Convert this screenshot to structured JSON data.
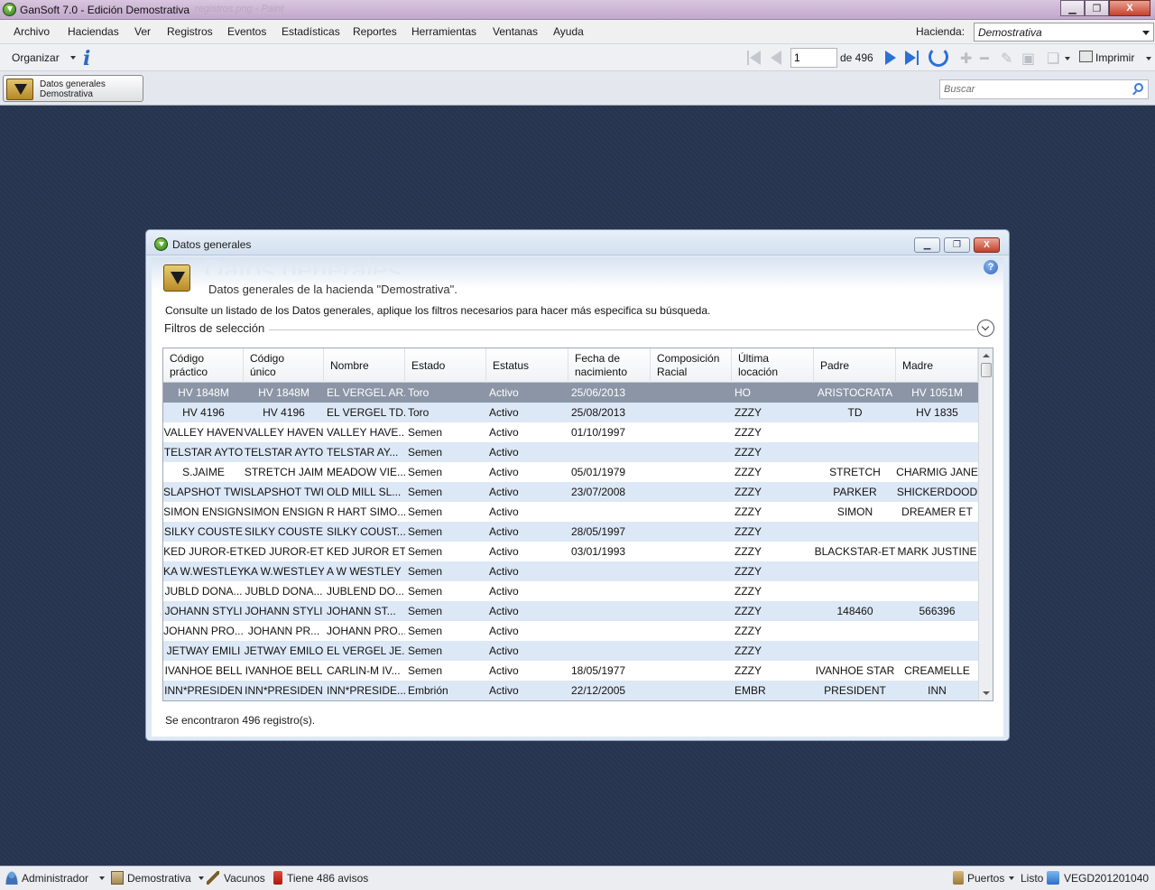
{
  "window": {
    "title": "GanSoft 7.0 - Edición Demostrativa",
    "ghost_text": "  registros.png - Paint",
    "min_label": "▁",
    "max_label": "❐",
    "close_label": "X"
  },
  "menu": {
    "items": [
      "Archivo",
      "Haciendas",
      "Ver",
      "Registros",
      "Eventos",
      "Estadísticas",
      "Reportes",
      "Herramientas",
      "Ventanas",
      "Ayuda"
    ],
    "hacienda_label": "Hacienda:",
    "hacienda_value": "Demostrativa"
  },
  "toolbar": {
    "organizar_label": "Organizar",
    "page_value": "1",
    "page_of": "de 496",
    "imprimir_label": "Imprimir"
  },
  "task_button": {
    "line1": "Datos generales",
    "line2": "Demostrativa"
  },
  "search": {
    "placeholder": "Buscar"
  },
  "inner_window": {
    "title": "Datos generales",
    "big_title": "Datos generales",
    "subtitle": "Datos generales de la hacienda \"Demostrativa\".",
    "description": "Consulte un listado de los Datos generales, aplique los filtros necesarios para hacer más especifica su búsqueda.",
    "filtros_label": "Filtros de selección",
    "help_label": "?",
    "result_text": "Se encontraron 496 registro(s)."
  },
  "table": {
    "columns": [
      "Código\npráctico",
      "Código\núnico",
      "Nombre",
      "Estado",
      "Estatus",
      "Fecha de\nnacimiento",
      "Composición\nRacial",
      "Última\nlocación",
      "Padre",
      "Madre"
    ],
    "rows": [
      [
        "HV 1848M",
        "HV 1848M",
        "EL VERGEL AR...",
        "Toro",
        "Activo",
        "25/06/2013",
        "",
        "HO",
        "ARISTOCRATA",
        "HV 1051M"
      ],
      [
        "HV 4196",
        "HV 4196",
        "EL VERGEL TD...",
        "Toro",
        "Activo",
        "25/08/2013",
        "",
        "ZZZY",
        "TD",
        "HV 1835"
      ],
      [
        "VALLEY HAVEN",
        "VALLEY HAVEN",
        "VALLEY HAVE...",
        "Semen",
        "Activo",
        "01/10/1997",
        "",
        "ZZZY",
        "",
        ""
      ],
      [
        "TELSTAR AYTO",
        "TELSTAR AYTO",
        "TELSTAR  AY...",
        "Semen",
        "Activo",
        "",
        "",
        "ZZZY",
        "",
        ""
      ],
      [
        "S.JAIME",
        "STRETCH JAIM",
        "MEADOW VIE...",
        "Semen",
        "Activo",
        "05/01/1979",
        "",
        "ZZZY",
        "STRETCH",
        "CHARMIG JANE"
      ],
      [
        "SLAPSHOT TWI",
        "SLAPSHOT TWI",
        "OLD MILL SL...",
        "Semen",
        "Activo",
        "23/07/2008",
        "",
        "ZZZY",
        "PARKER",
        "SHICKERDOOD"
      ],
      [
        "SIMON ENSIGN",
        "SIMON ENSIGN",
        "R HART SIMO...",
        "Semen",
        "Activo",
        "",
        "",
        "ZZZY",
        "SIMON",
        "DREAMER ET"
      ],
      [
        "SILKY COUSTE",
        "SILKY COUSTE",
        "SILKY COUST...",
        "Semen",
        "Activo",
        "28/05/1997",
        "",
        "ZZZY",
        "",
        ""
      ],
      [
        "KED JUROR-ET",
        "KED JUROR-ET",
        "KED JUROR ET",
        "Semen",
        "Activo",
        "03/01/1993",
        "",
        "ZZZY",
        "BLACKSTAR-ET",
        "MARK JUSTINE"
      ],
      [
        "KA W.WESTLEY",
        "KA W.WESTLEY",
        "A W WESTLEY",
        "Semen",
        "Activo",
        "",
        "",
        "ZZZY",
        "",
        ""
      ],
      [
        "JUBLD DONA...",
        "JUBLD DONA...",
        "JUBLEND DO...",
        "Semen",
        "Activo",
        "",
        "",
        "ZZZY",
        "",
        ""
      ],
      [
        "JOHANN STYLI",
        "JOHANN STYLI",
        "JOHANN ST...",
        "Semen",
        "Activo",
        "",
        "",
        "ZZZY",
        "148460",
        "566396"
      ],
      [
        "JOHANN PRO...",
        "JOHANN PR...",
        "JOHANN PRO...",
        "Semen",
        "Activo",
        "",
        "",
        "ZZZY",
        "",
        ""
      ],
      [
        "JETWAY EMILI",
        "JETWAY EMILO",
        "EL VERGEL JE...",
        "Semen",
        "Activo",
        "",
        "",
        "ZZZY",
        "",
        ""
      ],
      [
        "IVANHOE BELL",
        "IVANHOE BELL",
        "CARLIN-M IV...",
        "Semen",
        "Activo",
        "18/05/1977",
        "",
        "ZZZY",
        "IVANHOE STAR",
        "CREAMELLE"
      ],
      [
        "INN*PRESIDEN",
        "INN*PRESIDEN",
        "INN*PRESIDE...",
        "Embrión",
        "Activo",
        "22/12/2005",
        "",
        "EMBR",
        "PRESIDENT",
        "INN"
      ]
    ]
  },
  "statusbar": {
    "user": "Administrador",
    "hacienda": "Demostrativa",
    "vacunos": "Vacunos",
    "avisos": "Tiene 486 avisos",
    "puertos": "Puertos",
    "listo": "Listo",
    "code": "VEGD201201040"
  }
}
